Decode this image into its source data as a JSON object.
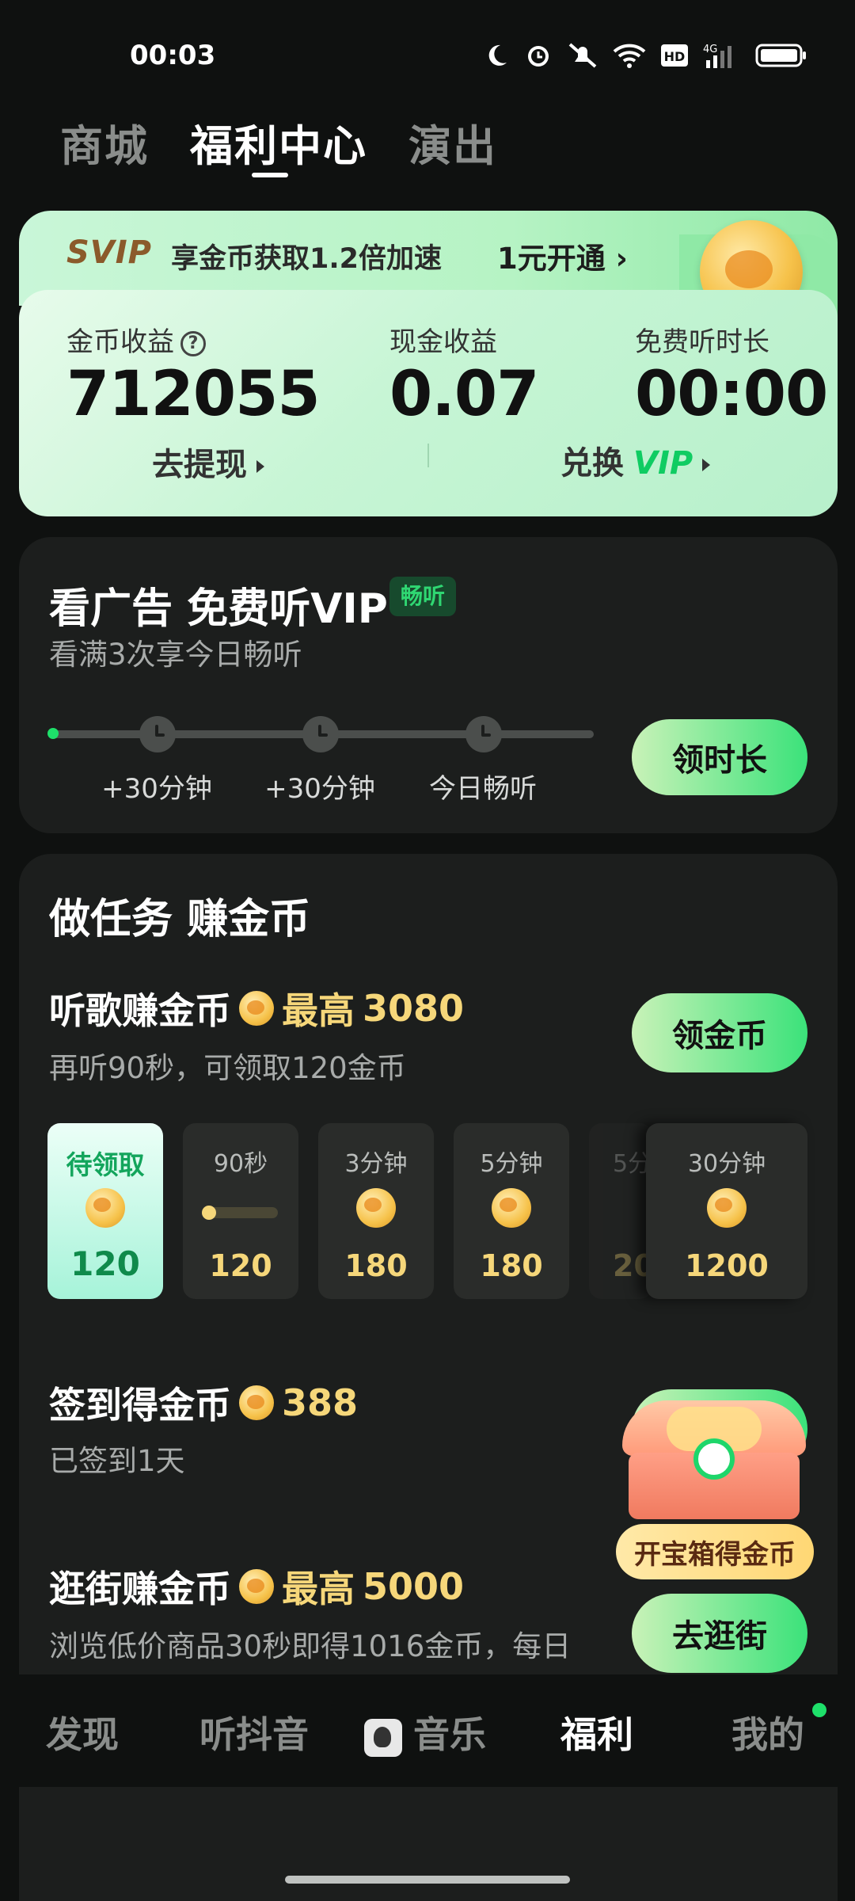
{
  "status_bar": {
    "time": "00:03",
    "network": "4G",
    "hd": "HD"
  },
  "top_tabs": [
    {
      "label": "商城",
      "active": false
    },
    {
      "label": "福利中心",
      "active": true
    },
    {
      "label": "演出",
      "active": false
    }
  ],
  "svip": {
    "badge": "SVIP",
    "promo": "享金币获取1.2倍加速",
    "open_label": "1元开通 ›",
    "stats": [
      {
        "label": "金币收益",
        "value": "712055",
        "help": "?"
      },
      {
        "label": "现金收益",
        "value": "0.07"
      },
      {
        "label": "免费听时长",
        "value": "00:00"
      }
    ],
    "withdraw_label": "去提现",
    "exchange_label": "兑换",
    "exchange_vip": "VIP"
  },
  "ad_card": {
    "title": "看广告 免费听VIP",
    "badge": "畅听",
    "subtitle": "看满3次享今日畅听",
    "steps": [
      "+30分钟",
      "+30分钟",
      "今日畅听"
    ],
    "button": "领时长"
  },
  "tasks": {
    "title": "做任务 赚金币",
    "listen": {
      "title": "听歌赚金币",
      "max_prefix": "最高",
      "max_value": "3080",
      "subtitle": "再听90秒，可领取120金币",
      "button": "领金币",
      "rewards": [
        {
          "label": "待领取",
          "value": "120",
          "state": "claimable"
        },
        {
          "label": "90秒",
          "value": "120",
          "state": "progress",
          "progress": 0.1
        },
        {
          "label": "3分钟",
          "value": "180",
          "state": "locked"
        },
        {
          "label": "5分钟",
          "value": "180",
          "state": "locked"
        },
        {
          "label": "5分",
          "value": "20",
          "state": "faded"
        },
        {
          "label": "30分钟",
          "value": "1200",
          "state": "locked"
        }
      ]
    },
    "signin": {
      "title": "签到得金币",
      "value": "388",
      "subtitle": "已签到1天"
    },
    "shopping": {
      "title": "逛街赚金币",
      "max_prefix": "最高",
      "max_value": "5000",
      "subtitle": "浏览低价商品30秒即得1016金币，每日",
      "button": "去逛街"
    },
    "treasure_label": "开宝箱得金币"
  },
  "bottom_nav": [
    {
      "label": "发现",
      "active": false
    },
    {
      "label": "听抖音",
      "active": false
    },
    {
      "label": "音乐",
      "active": false
    },
    {
      "label": "福利",
      "active": true
    },
    {
      "label": "我的",
      "active": false
    }
  ],
  "colors": {
    "accent_green": "#1ee06a",
    "gold": "#f6d77a",
    "background": "#0f1110"
  }
}
